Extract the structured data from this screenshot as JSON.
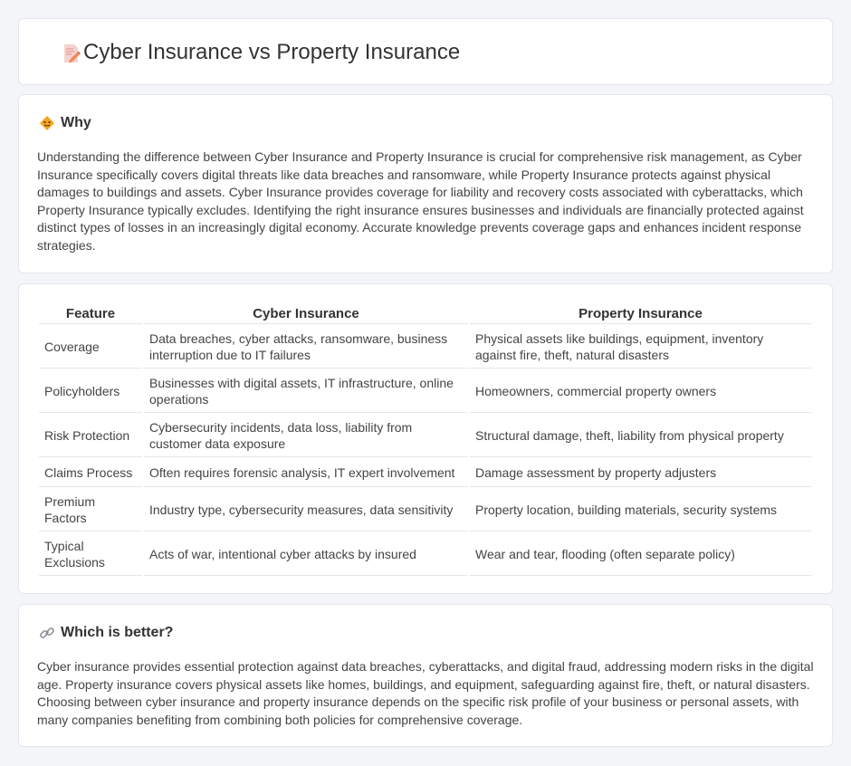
{
  "header": {
    "title": "Cyber Insurance vs Property Insurance",
    "icon": "document-pencil-icon"
  },
  "why": {
    "title": "Why",
    "icon": "warning-diamond-icon",
    "text": "Understanding the difference between Cyber Insurance and Property Insurance is crucial for comprehensive risk management, as Cyber Insurance specifically covers digital threats like data breaches and ransomware, while Property Insurance protects against physical damages to buildings and assets. Cyber Insurance provides coverage for liability and recovery costs associated with cyberattacks, which Property Insurance typically excludes. Identifying the right insurance ensures businesses and individuals are financially protected against distinct types of losses in an increasingly digital economy. Accurate knowledge prevents coverage gaps and enhances incident response strategies."
  },
  "table": {
    "headers": [
      "Feature",
      "Cyber Insurance",
      "Property Insurance"
    ],
    "rows": [
      [
        "Coverage",
        "Data breaches, cyber attacks, ransomware, business interruption due to IT failures",
        "Physical assets like buildings, equipment, inventory against fire, theft, natural disasters"
      ],
      [
        "Policyholders",
        "Businesses with digital assets, IT infrastructure, online operations",
        "Homeowners, commercial property owners"
      ],
      [
        "Risk Protection",
        "Cybersecurity incidents, data loss, liability from customer data exposure",
        "Structural damage, theft, liability from physical property"
      ],
      [
        "Claims Process",
        "Often requires forensic analysis, IT expert involvement",
        "Damage assessment by property adjusters"
      ],
      [
        "Premium Factors",
        "Industry type, cybersecurity measures, data sensitivity",
        "Property location, building materials, security systems"
      ],
      [
        "Typical Exclusions",
        "Acts of war, intentional cyber attacks by insured",
        "Wear and tear, flooding (often separate policy)"
      ]
    ]
  },
  "better": {
    "title": "Which is better?",
    "icon": "link-icon",
    "text": "Cyber insurance provides essential protection against data breaches, cyberattacks, and digital fraud, addressing modern risks in the digital age. Property insurance covers physical assets like homes, buildings, and equipment, safeguarding against fire, theft, or natural disasters. Choosing between cyber insurance and property insurance depends on the specific risk profile of your business or personal assets, with many companies benefiting from combining both policies for comprehensive coverage."
  }
}
